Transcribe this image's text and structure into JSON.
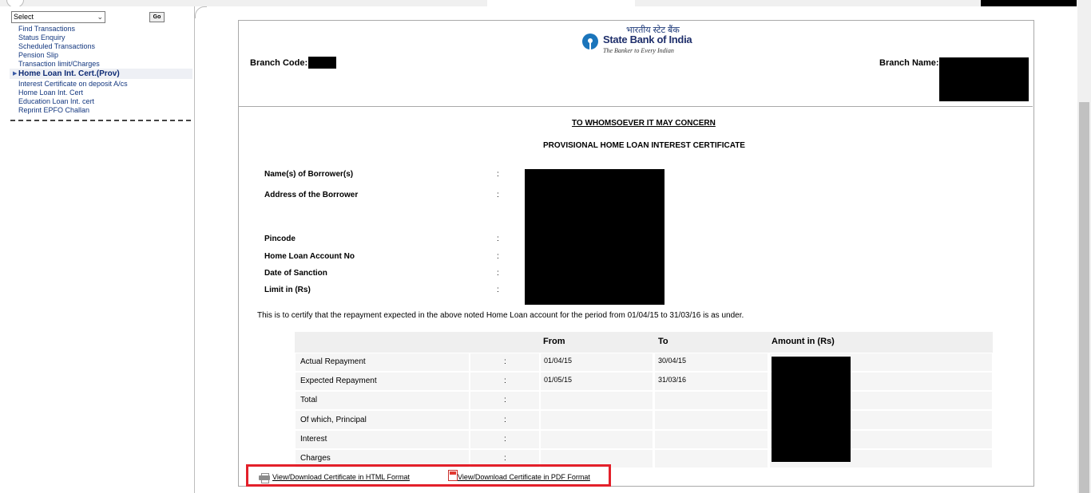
{
  "sidebar": {
    "select_value": "Select",
    "go_label": "Go",
    "items": [
      {
        "label": "Find Transactions"
      },
      {
        "label": "Status Enquiry"
      },
      {
        "label": "Scheduled Transactions"
      },
      {
        "label": "Pension Slip"
      },
      {
        "label": "Transaction limit/Charges"
      },
      {
        "label": "Home Loan Int. Cert.(Prov)"
      },
      {
        "label": "Interest Certificate on deposit A/cs"
      },
      {
        "label": "Home Loan Int. Cert"
      },
      {
        "label": "Education Loan Int. cert"
      },
      {
        "label": "Reprint EPFO Challan"
      }
    ]
  },
  "header": {
    "hindi_name": "भारतीय स्टेट बैंक",
    "bank_name": "State Bank of India",
    "tagline": "The Banker to Every Indian",
    "branch_code_label": "Branch Code:",
    "branch_name_label": "Branch Name:"
  },
  "certificate": {
    "concern_heading": "TO WHOMSOEVER IT MAY CONCERN",
    "title": "PROVISIONAL HOME LOAN INTEREST CERTIFICATE",
    "fields": {
      "borrower_names": "Name(s) of Borrower(s)",
      "address": "Address of the Borrower",
      "pincode": "Pincode",
      "account_no": "Home Loan Account No",
      "sanction_date": "Date of Sanction",
      "limit": "Limit in (Rs)"
    },
    "colon": ":",
    "statement": "This is to certify that the repayment expected in the above noted Home Loan account for the period from 01/04/15 to 31/03/16 is as under."
  },
  "table": {
    "headers": {
      "from": "From",
      "to": "To",
      "amount": "Amount in (Rs)"
    },
    "rows": [
      {
        "label": "Actual Repayment",
        "from": "01/04/15",
        "to": "30/04/15"
      },
      {
        "label": "Expected Repayment",
        "from": "01/05/15",
        "to": "31/03/16"
      },
      {
        "label": "Total",
        "from": "",
        "to": ""
      },
      {
        "label": "Of which, Principal",
        "from": "",
        "to": ""
      },
      {
        "label": "Interest",
        "from": "",
        "to": ""
      },
      {
        "label": "Charges",
        "from": "",
        "to": ""
      }
    ]
  },
  "downloads": {
    "html_label": "View/Download Certificate in HTML Format",
    "pdf_label": "View/Download Certificate in PDF Format",
    "highlight_color": "#e3202a"
  }
}
